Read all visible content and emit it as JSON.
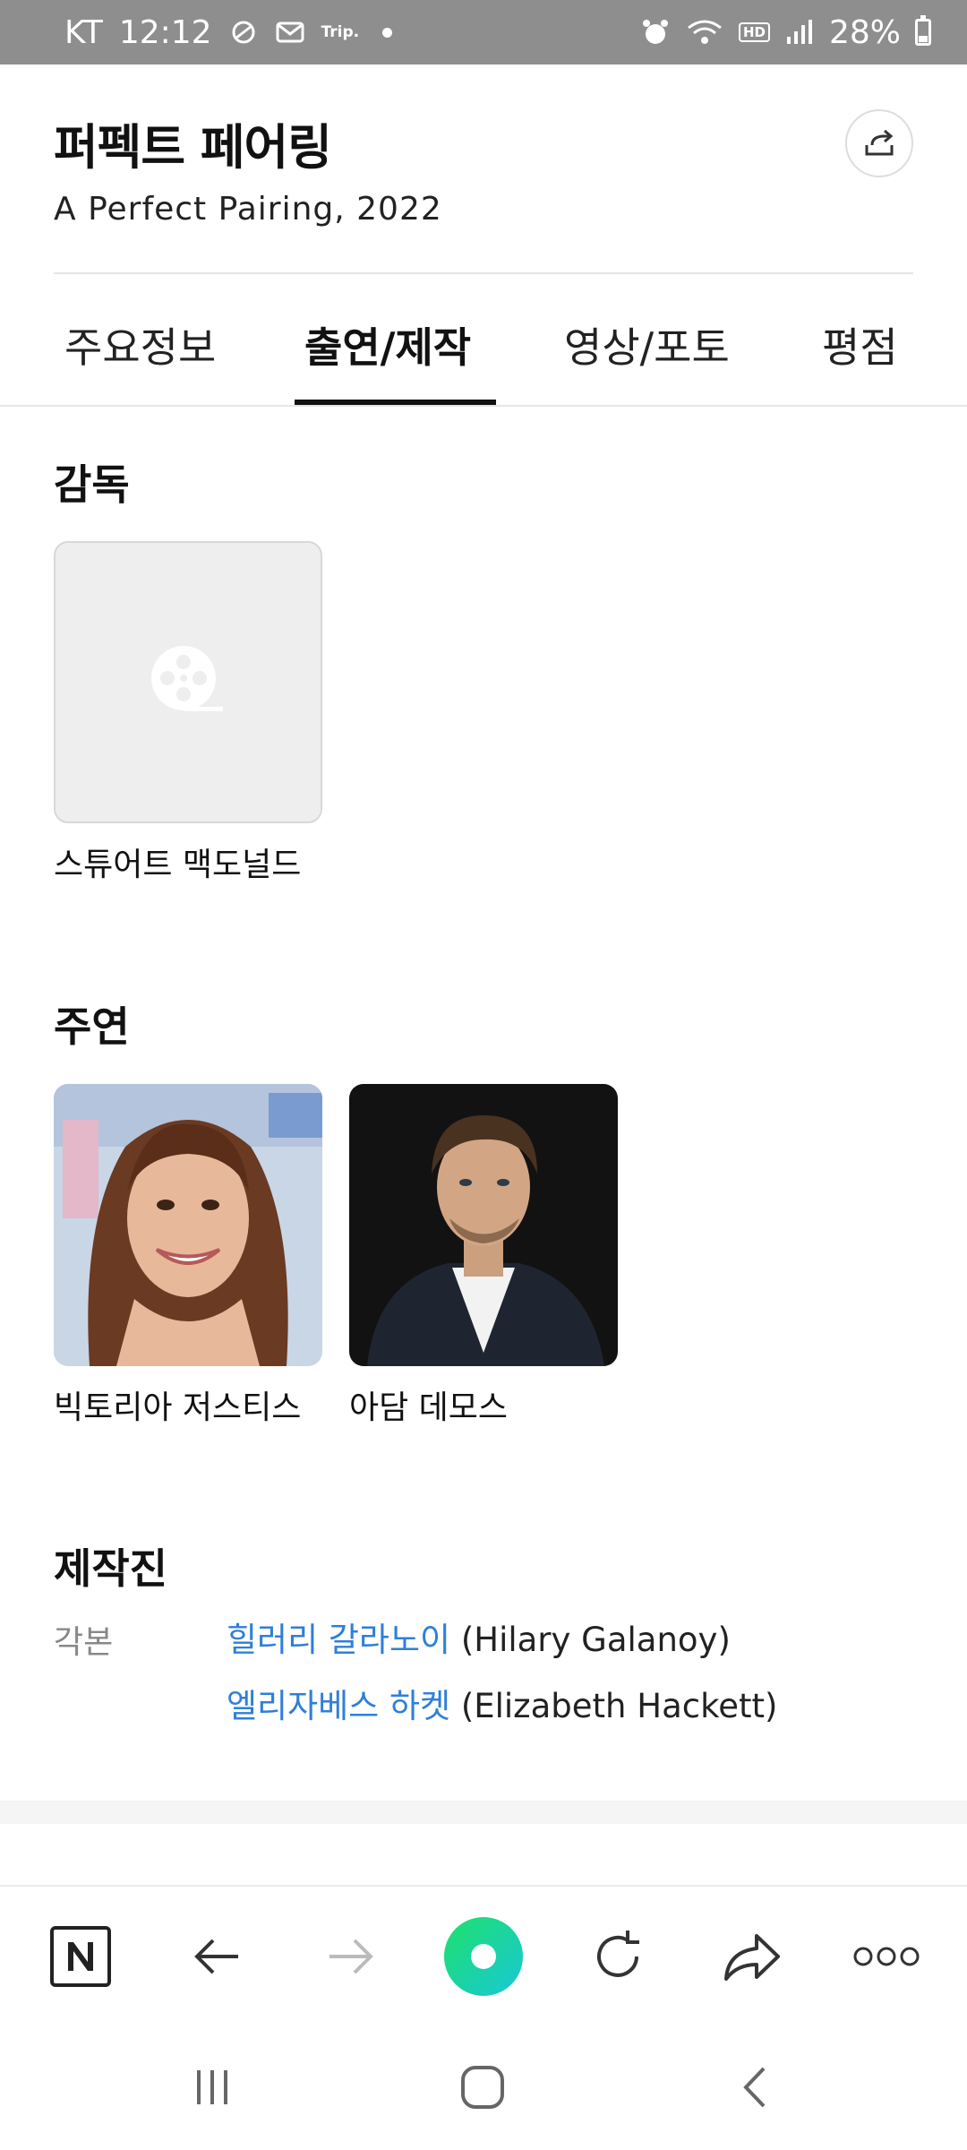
{
  "status_bar": {
    "carrier": "KT",
    "time": "12:12",
    "app_badge": "Trip.",
    "network": "HD",
    "battery": "28%",
    "battery_level": 0.28
  },
  "header": {
    "title": "퍼펙트 페어링",
    "subtitle": "A Perfect Pairing, 2022"
  },
  "tabs": [
    {
      "label": "주요정보",
      "active": false
    },
    {
      "label": "출연/제작",
      "active": true
    },
    {
      "label": "영상/포토",
      "active": false
    },
    {
      "label": "평점",
      "active": false
    }
  ],
  "director_section": {
    "title": "감독",
    "people": [
      {
        "name": "스튜어트 맥도널드",
        "photo": "film-reel-placeholder-icon"
      }
    ]
  },
  "cast_section": {
    "title": "주연",
    "people": [
      {
        "name": "빅토리아 저스티스",
        "photo": "portrait-woman-smiling"
      },
      {
        "name": "아담 데모스",
        "photo": "portrait-man-dark-jacket"
      }
    ]
  },
  "crew_section": {
    "title": "제작진",
    "role": "각본",
    "members": [
      {
        "name_kr": "힐러리 갈라노이",
        "name_en": "(Hilary Galanoy)"
      },
      {
        "name_kr": "엘리자베스 하켓",
        "name_en": "(Elizabeth Hackett)"
      }
    ]
  },
  "toolbar": {
    "items": [
      "naver-home-icon",
      "back-arrow-icon",
      "forward-arrow-icon",
      "green-dot-icon",
      "refresh-icon",
      "share-arrow-icon",
      "more-icon"
    ],
    "accent": "#1ed98a"
  },
  "nav": {
    "items": [
      "recent-apps-icon",
      "home-icon",
      "back-icon"
    ]
  }
}
